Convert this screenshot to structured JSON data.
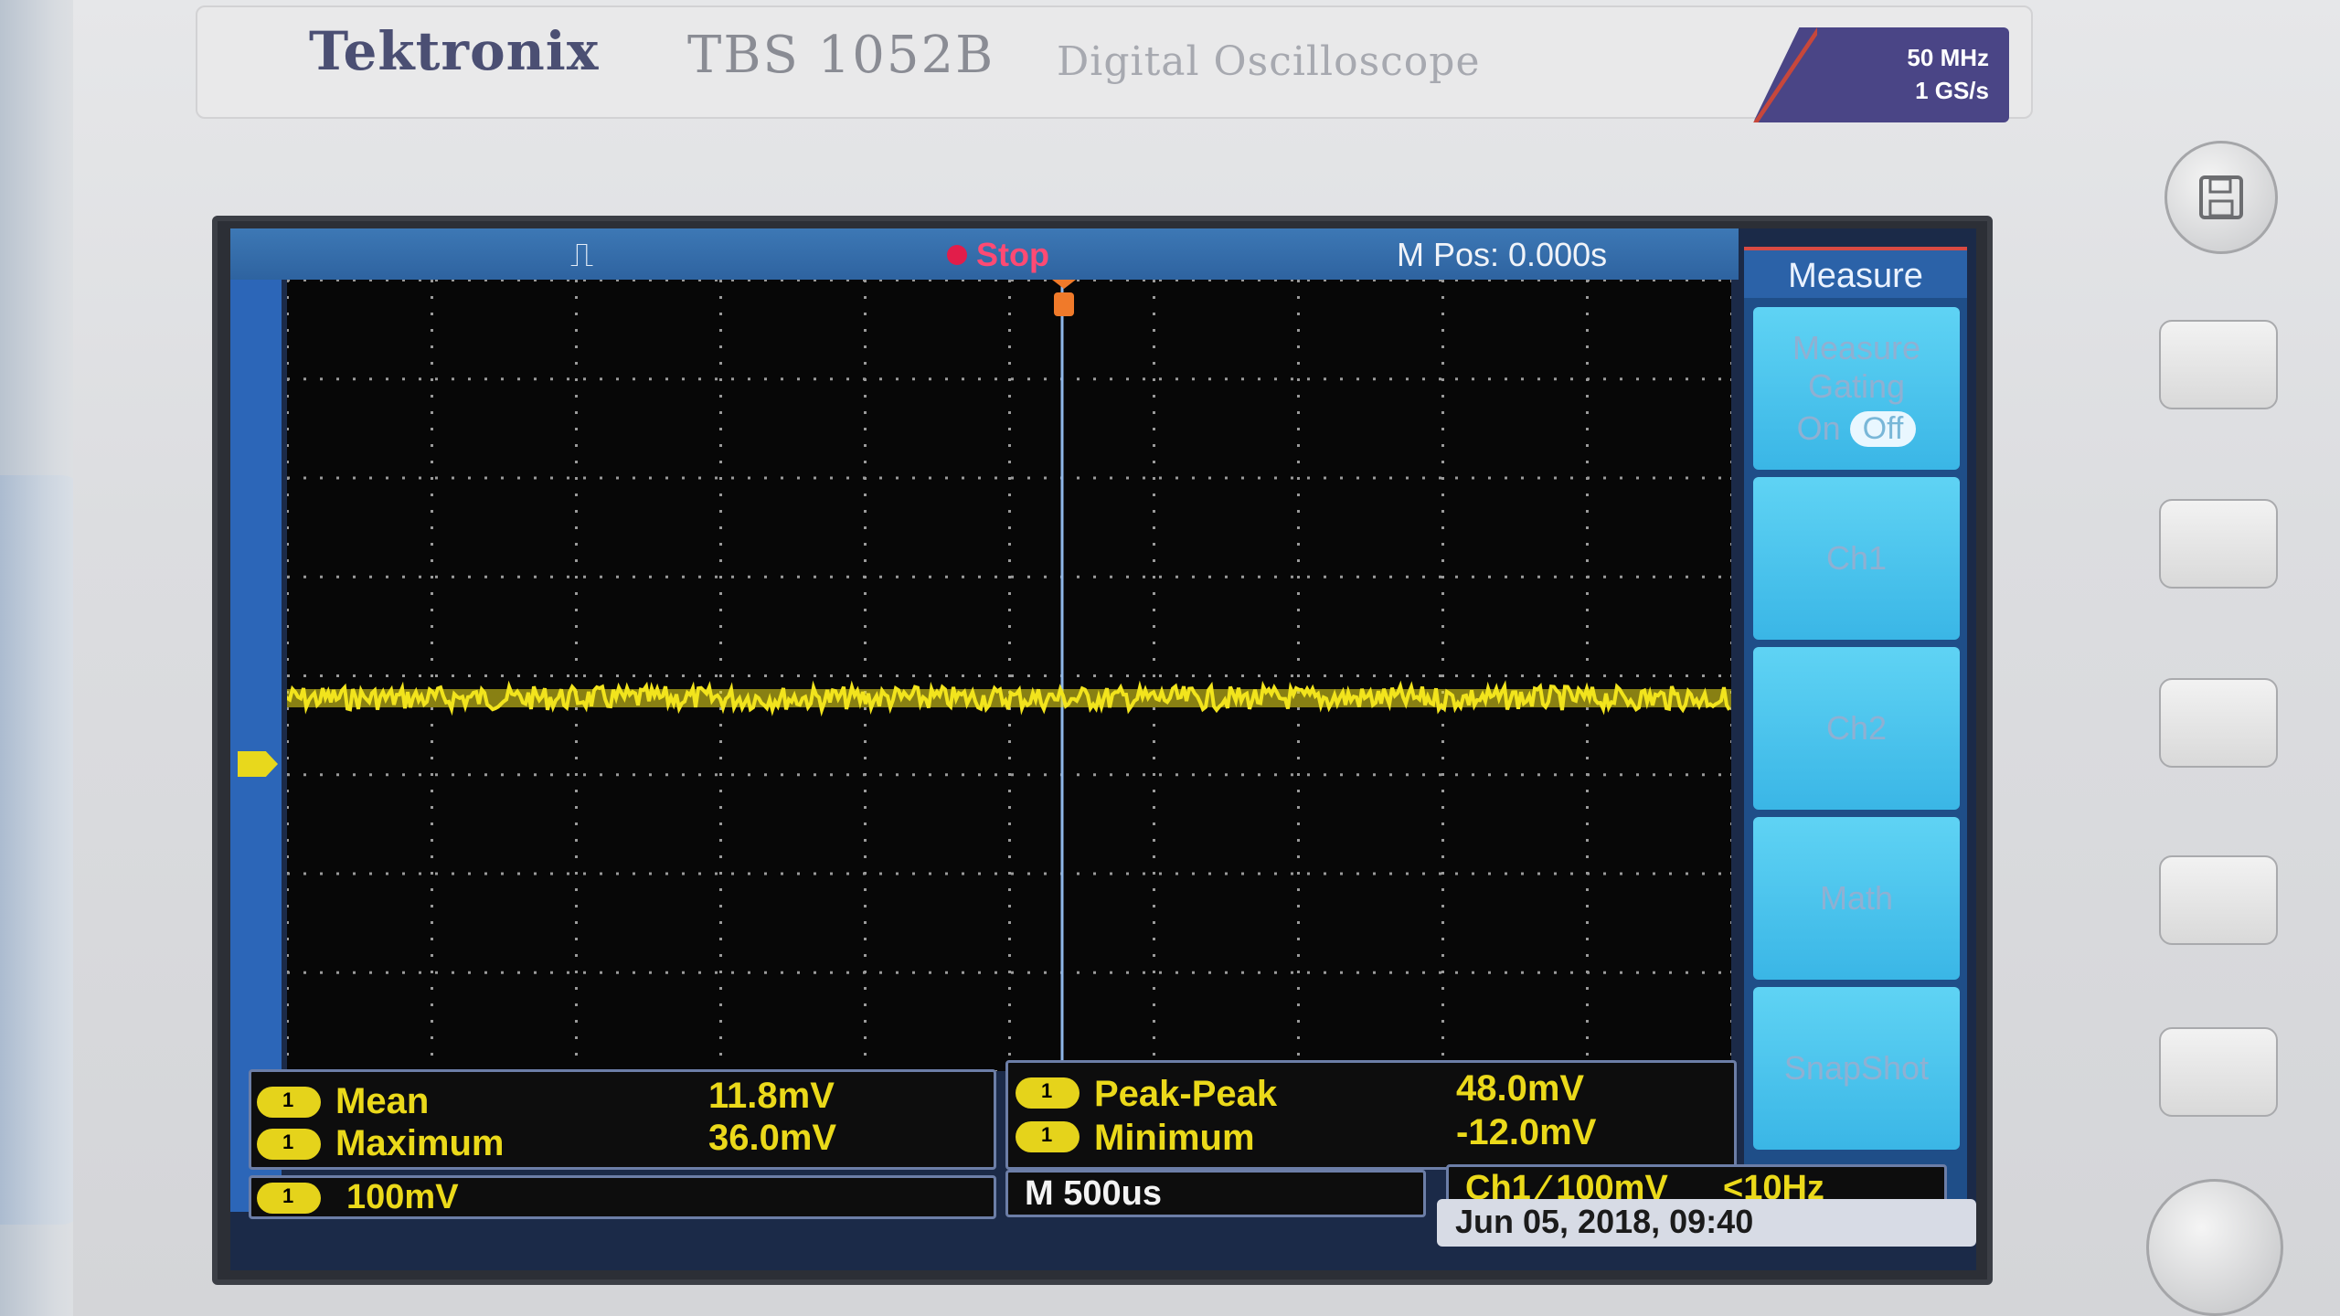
{
  "device": {
    "brand": "Tektronix",
    "model": "TBS 1052B",
    "description": "Digital Oscilloscope",
    "spec_bandwidth": "50 MHz",
    "spec_sample_rate": "1 GS/s"
  },
  "top_bar": {
    "run_state": "Stop",
    "horizontal_position": "M Pos: 0.000s"
  },
  "menu": {
    "title": "Measure",
    "gating": {
      "label_line1": "Measure",
      "label_line2": "Gating",
      "on_label": "On",
      "off_label": "Off",
      "selected": "Off"
    },
    "buttons": [
      "Ch1",
      "Ch2",
      "Math",
      "SnapShot"
    ]
  },
  "measurements": {
    "panel1": [
      {
        "channel": "1",
        "name": "Mean",
        "value": "11.8mV"
      },
      {
        "channel": "1",
        "name": "Maximum",
        "value": "36.0mV"
      }
    ],
    "panel2": [
      {
        "channel": "1",
        "name": "Peak-Peak",
        "value": "48.0mV"
      },
      {
        "channel": "1",
        "name": "Minimum",
        "value": "-12.0mV"
      }
    ]
  },
  "status": {
    "ch1_scale": "100mV",
    "timebase": "M 500us",
    "trigger": "Ch1 ∕ 100mV",
    "trigger_freq": "<10Hz",
    "datetime": "Jun 05, 2018, 09:40"
  },
  "colors": {
    "trace": "#f2e41d",
    "brand_badge": "#4a4586",
    "menu_button": "#3ab6e6"
  }
}
